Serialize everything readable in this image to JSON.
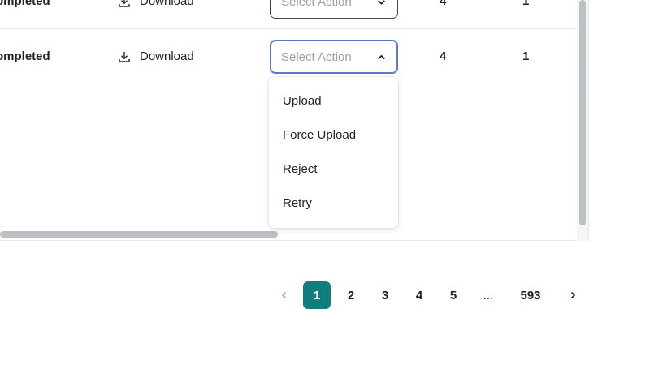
{
  "rows": [
    {
      "status": "ompleted",
      "download_label": "Download",
      "select_placeholder": "Select Action",
      "col_a": "4",
      "col_b": "1"
    },
    {
      "status": "ompleted",
      "download_label": "Download",
      "select_placeholder": "Select Action",
      "col_a": "4",
      "col_b": "1"
    }
  ],
  "dropdown": {
    "items": [
      "Upload",
      "Force Upload",
      "Reject",
      "Retry"
    ]
  },
  "pagination": {
    "pages": [
      "1",
      "2",
      "3",
      "4",
      "5",
      "...",
      "593"
    ],
    "current": "1"
  },
  "colors": {
    "accent": "#0f7e7c",
    "focus_border": "#5a78c7"
  },
  "icons": {
    "download": "download-icon",
    "chevron_down": "chevron-down-icon",
    "chevron_up": "chevron-up-icon",
    "prev": "chevron-left-icon",
    "next": "chevron-right-icon"
  }
}
